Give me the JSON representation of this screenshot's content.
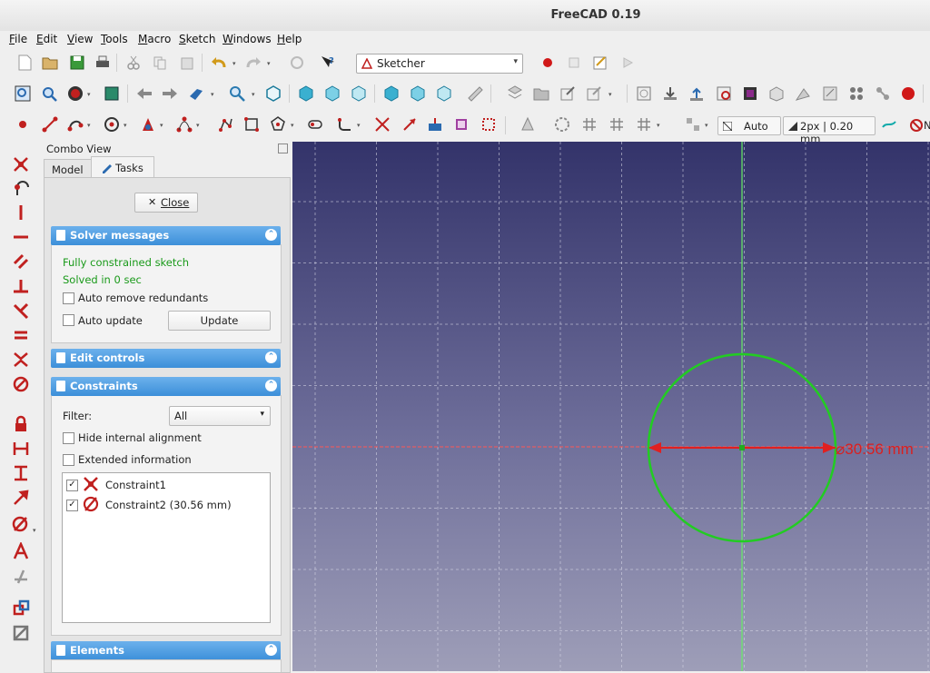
{
  "window": {
    "title": "FreeCAD 0.19"
  },
  "menu": [
    "File",
    "Edit",
    "View",
    "Tools",
    "Macro",
    "Sketch",
    "Windows",
    "Help"
  ],
  "toolbar": {
    "workbench": "Sketcher",
    "auto_label": "Auto",
    "line_style": "2px | 0.20 mm",
    "cut_label": "N"
  },
  "combo": {
    "title": "Combo View",
    "tabs": {
      "model": "Model",
      "tasks": "Tasks"
    },
    "close_button": "Close",
    "solver": {
      "title": "Solver messages",
      "status1": "Fully constrained sketch",
      "status2": "Solved in 0 sec",
      "auto_remove_label": "Auto remove redundants",
      "auto_update_label": "Auto update",
      "update_button": "Update"
    },
    "edit_controls": {
      "title": "Edit controls"
    },
    "constraints": {
      "title": "Constraints",
      "filter_label": "Filter:",
      "filter_value": "All",
      "hide_internal_label": "Hide internal alignment",
      "extended_info_label": "Extended information",
      "items": [
        {
          "label": "Constraint1",
          "icon": "coincident-icon",
          "checked": true
        },
        {
          "label": "Constraint2 (30.56 mm)",
          "icon": "diameter-icon",
          "checked": true
        }
      ]
    },
    "elements": {
      "title": "Elements"
    }
  },
  "sketch": {
    "dimension_label": "⌀30.56 mm",
    "colors": {
      "circle": "#22cc22",
      "axis_vertical": "#66ee66",
      "dimension": "#e02020",
      "background_top": "#33336a",
      "background_bottom": "#9e9eb8"
    }
  },
  "colors": {
    "panel_header": "#3c8fd9",
    "icon_red": "#c0201f",
    "solver_text": "#1a9a1a"
  }
}
